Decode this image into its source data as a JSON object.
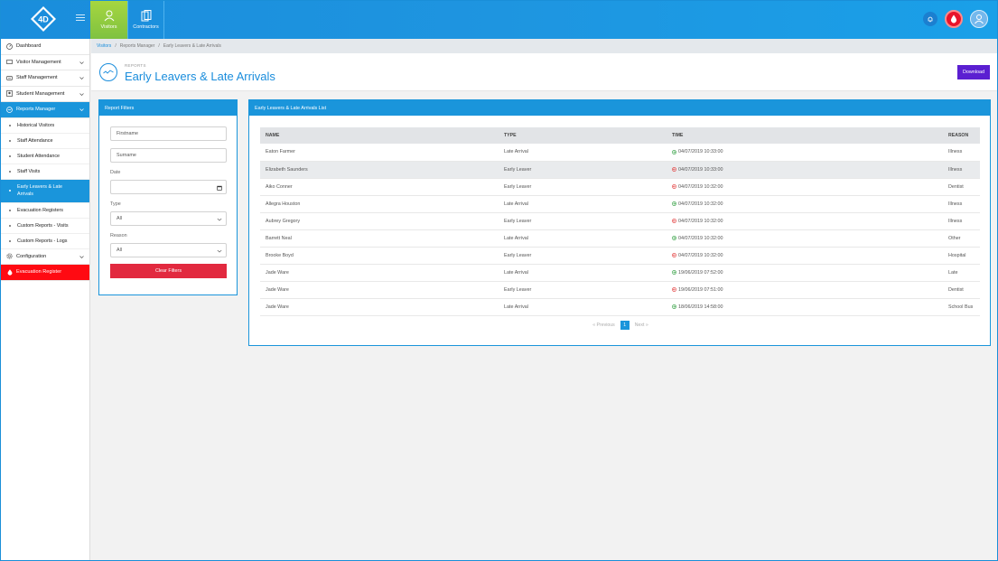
{
  "topbar": {
    "logo_text": "4D",
    "nav": [
      {
        "label": "Visitors",
        "icon": "person-icon"
      },
      {
        "label": "Contractors",
        "icon": "documents-icon"
      }
    ]
  },
  "sidebar": {
    "items": [
      {
        "label": "Dashboard",
        "icon": "dashboard-icon"
      },
      {
        "label": "Visitor Management",
        "icon": "visitor-card-icon"
      },
      {
        "label": "Staff Management",
        "icon": "staff-icon"
      },
      {
        "label": "Student Management",
        "icon": "student-icon"
      },
      {
        "label": "Reports Manager",
        "icon": "reports-icon"
      }
    ],
    "sub_items": [
      "Historical Visitors",
      "Staff Attendance",
      "Student Attendance",
      "Staff Visits",
      "Early Leavers & Late Arrivals",
      "Evacuation Registers",
      "Custom Reports - Visits",
      "Custom Reports - Logs"
    ],
    "configuration_label": "Configuration",
    "evacuation_label": "Evacuation Register"
  },
  "breadcrumb": {
    "items": [
      "Visitors",
      "Reports Manager",
      "Early Leavers & Late Arrivals"
    ]
  },
  "header": {
    "eyebrow": "REPORTS",
    "title": "Early Leavers & Late Arrivals",
    "download_label": "Download"
  },
  "filters": {
    "title": "Report Filters",
    "firstname_placeholder": "Firstname",
    "surname_placeholder": "Surname",
    "date_label": "Date",
    "type_label": "Type",
    "type_value": "All",
    "reason_label": "Reason",
    "reason_value": "All",
    "clear_label": "Clear Filters"
  },
  "list": {
    "title": "Early Leavers & Late Arrivals List",
    "columns": [
      "NAME",
      "TYPE",
      "TIME",
      "REASON"
    ],
    "rows": [
      {
        "name": "Eaton Farmer",
        "type": "Late Arrival",
        "time": "04/07/2019 10:33:00",
        "reason": "Illness",
        "kind": "in"
      },
      {
        "name": "Elizabeth Saunders",
        "type": "Early Leaver",
        "time": "04/07/2019 10:33:00",
        "reason": "Illness",
        "kind": "out"
      },
      {
        "name": "Aiko Conner",
        "type": "Early Leaver",
        "time": "04/07/2019 10:32:00",
        "reason": "Dentist",
        "kind": "out"
      },
      {
        "name": "Allegra Houston",
        "type": "Late Arrival",
        "time": "04/07/2019 10:32:00",
        "reason": "Illness",
        "kind": "in"
      },
      {
        "name": "Aubrey Gregory",
        "type": "Early Leaver",
        "time": "04/07/2019 10:32:00",
        "reason": "Illness",
        "kind": "out"
      },
      {
        "name": "Barrett Neal",
        "type": "Late Arrival",
        "time": "04/07/2019 10:32:00",
        "reason": "Other",
        "kind": "in"
      },
      {
        "name": "Brooke Boyd",
        "type": "Early Leaver",
        "time": "04/07/2019 10:32:00",
        "reason": "Hospital",
        "kind": "out"
      },
      {
        "name": "Jade Ware",
        "type": "Late Arrival",
        "time": "19/06/2019 07:52:00",
        "reason": "Late",
        "kind": "in"
      },
      {
        "name": "Jade Ware",
        "type": "Early Leaver",
        "time": "19/06/2019 07:51:00",
        "reason": "Dentist",
        "kind": "out"
      },
      {
        "name": "Jade Ware",
        "type": "Late Arrival",
        "time": "18/06/2019 14:58:00",
        "reason": "School Bus",
        "kind": "in"
      }
    ],
    "pager": {
      "previous": "« Previous",
      "page": "1",
      "next": "Next »"
    }
  },
  "colors": {
    "primary": "#1a95db",
    "active_nav": "#8cc63f",
    "download": "#5b1fd1",
    "clear": "#e2293f",
    "evacuation": "#ff0a12",
    "arrival": "#2e9e3e",
    "leaver": "#e23a3a"
  }
}
